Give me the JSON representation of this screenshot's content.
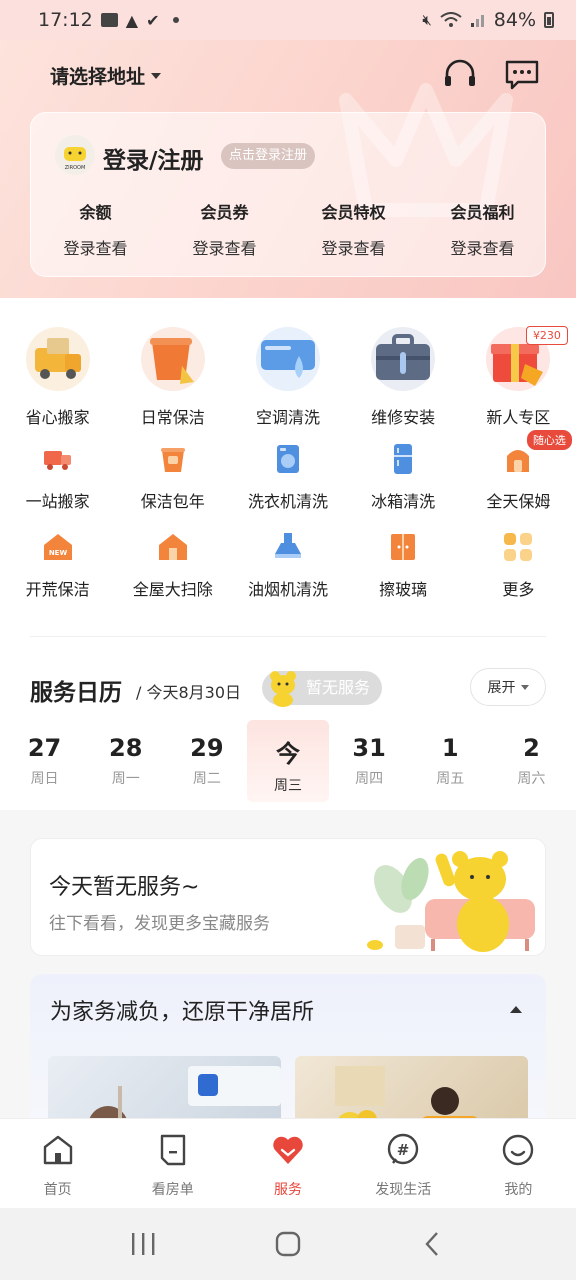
{
  "status_bar": {
    "time": "17:12",
    "battery": "84%"
  },
  "header": {
    "address": "请选择地址"
  },
  "login_card": {
    "title": "登录/注册",
    "pill": "点击登录注册",
    "avatar_text": "ZIROOM",
    "stats": [
      {
        "title": "余额",
        "value": "登录查看"
      },
      {
        "title": "会员券",
        "value": "登录查看"
      },
      {
        "title": "会员特权",
        "value": "登录查看"
      },
      {
        "title": "会员福利",
        "value": "登录查看"
      }
    ]
  },
  "services_main": [
    {
      "label": "省心搬家",
      "icon": "moving-truck-icon"
    },
    {
      "label": "日常保洁",
      "icon": "cleaning-bucket-icon"
    },
    {
      "label": "空调清洗",
      "icon": "ac-cleaning-icon"
    },
    {
      "label": "维修安装",
      "icon": "toolbox-icon"
    },
    {
      "label": "新人专区",
      "icon": "gift-icon",
      "badge": "¥230"
    }
  ],
  "services_row2": [
    {
      "label": "一站搬家",
      "icon": "truck-icon"
    },
    {
      "label": "保洁包年",
      "icon": "bucket-icon"
    },
    {
      "label": "洗衣机清洗",
      "icon": "washing-machine-icon"
    },
    {
      "label": "冰箱清洗",
      "icon": "fridge-icon"
    },
    {
      "label": "全天保姆",
      "icon": "nanny-icon",
      "badge": "随心选"
    }
  ],
  "services_row3": [
    {
      "label": "开荒保洁",
      "icon": "new-house-icon",
      "icon_text": "NEW"
    },
    {
      "label": "全屋大扫除",
      "icon": "house-clean-icon"
    },
    {
      "label": "油烟机清洗",
      "icon": "range-hood-icon"
    },
    {
      "label": "擦玻璃",
      "icon": "window-icon"
    },
    {
      "label": "更多",
      "icon": "more-grid-icon"
    }
  ],
  "calendar": {
    "title": "服务日历",
    "subtitle": "/ 今天8月30日",
    "no_service": "暂无服务",
    "expand": "展开",
    "days": [
      {
        "num": "27",
        "week": "周日"
      },
      {
        "num": "28",
        "week": "周一"
      },
      {
        "num": "29",
        "week": "周二"
      },
      {
        "num": "今",
        "week": "周三",
        "today": true
      },
      {
        "num": "31",
        "week": "周四"
      },
      {
        "num": "1",
        "week": "周五"
      },
      {
        "num": "2",
        "week": "周六"
      }
    ]
  },
  "empty_card": {
    "title": "今天暂无服务~",
    "subtitle": "往下看看，发现更多宝藏服务"
  },
  "promo": {
    "title": "为家务减负，还原干净居所"
  },
  "tabs": [
    {
      "label": "首页",
      "icon": "home-icon"
    },
    {
      "label": "看房单",
      "icon": "list-icon"
    },
    {
      "label": "服务",
      "icon": "heart-icon",
      "active": true
    },
    {
      "label": "发现生活",
      "icon": "hashtag-icon"
    },
    {
      "label": "我的",
      "icon": "smile-icon"
    }
  ],
  "colors": {
    "accent": "#e8473b",
    "header_bg": "#fbd3cc"
  }
}
